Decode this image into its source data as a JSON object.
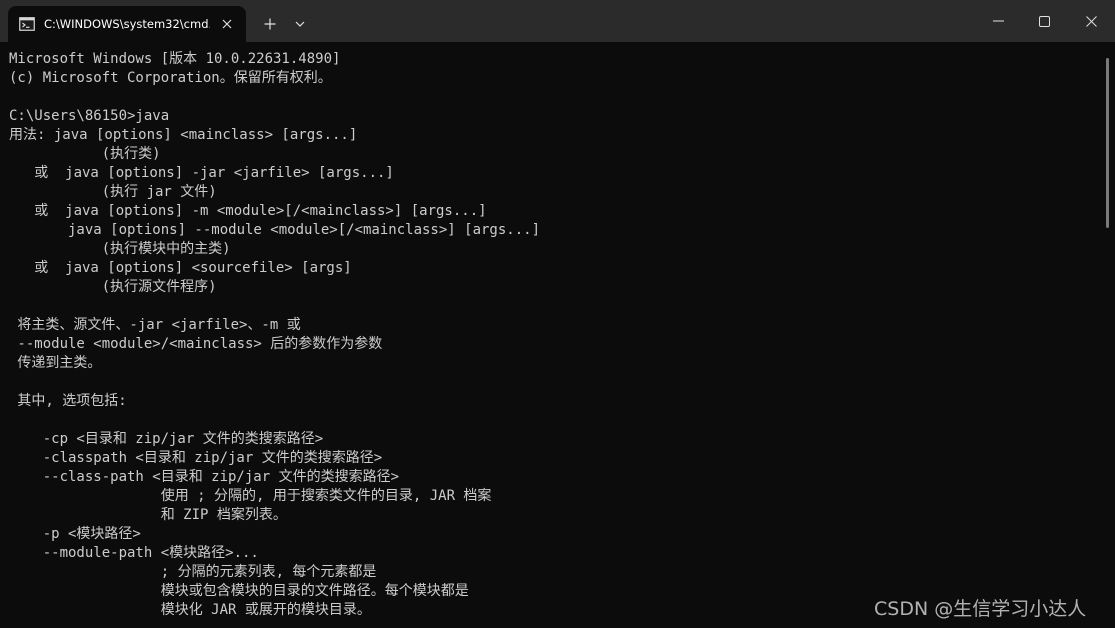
{
  "window": {
    "tab_title": "C:\\WINDOWS\\system32\\cmd.",
    "icons": {
      "tab": "terminal-icon",
      "tab_close": "close-icon",
      "new_tab": "plus-icon",
      "dropdown": "chevron-down-icon",
      "minimize": "minimize-icon",
      "maximize": "maximize-icon",
      "close": "close-icon"
    }
  },
  "console": {
    "lines": [
      "Microsoft Windows [版本 10.0.22631.4890]",
      "(c) Microsoft Corporation。保留所有权利。",
      "",
      "C:\\Users\\86150>java",
      "用法: java [options] <mainclass> [args...]",
      "           (执行类)",
      "   或  java [options] -jar <jarfile> [args...]",
      "           (执行 jar 文件)",
      "   或  java [options] -m <module>[/<mainclass>] [args...]",
      "       java [options] --module <module>[/<mainclass>] [args...]",
      "           (执行模块中的主类)",
      "   或  java [options] <sourcefile> [args]",
      "           (执行源文件程序)",
      "",
      " 将主类、源文件、-jar <jarfile>、-m 或",
      " --module <module>/<mainclass> 后的参数作为参数",
      " 传递到主类。",
      "",
      " 其中, 选项包括:",
      "",
      "    -cp <目录和 zip/jar 文件的类搜索路径>",
      "    -classpath <目录和 zip/jar 文件的类搜索路径>",
      "    --class-path <目录和 zip/jar 文件的类搜索路径>",
      "                  使用 ; 分隔的, 用于搜索类文件的目录, JAR 档案",
      "                  和 ZIP 档案列表。",
      "    -p <模块路径>",
      "    --module-path <模块路径>...",
      "                  ; 分隔的元素列表, 每个元素都是",
      "                  模块或包含模块的目录的文件路径。每个模块都是",
      "                  模块化 JAR 或展开的模块目录。"
    ]
  },
  "watermark": "CSDN @生信学习小达人",
  "colors": {
    "background": "#0c0c0c",
    "titlebar": "#2b2b2b",
    "text": "#cccccc"
  }
}
